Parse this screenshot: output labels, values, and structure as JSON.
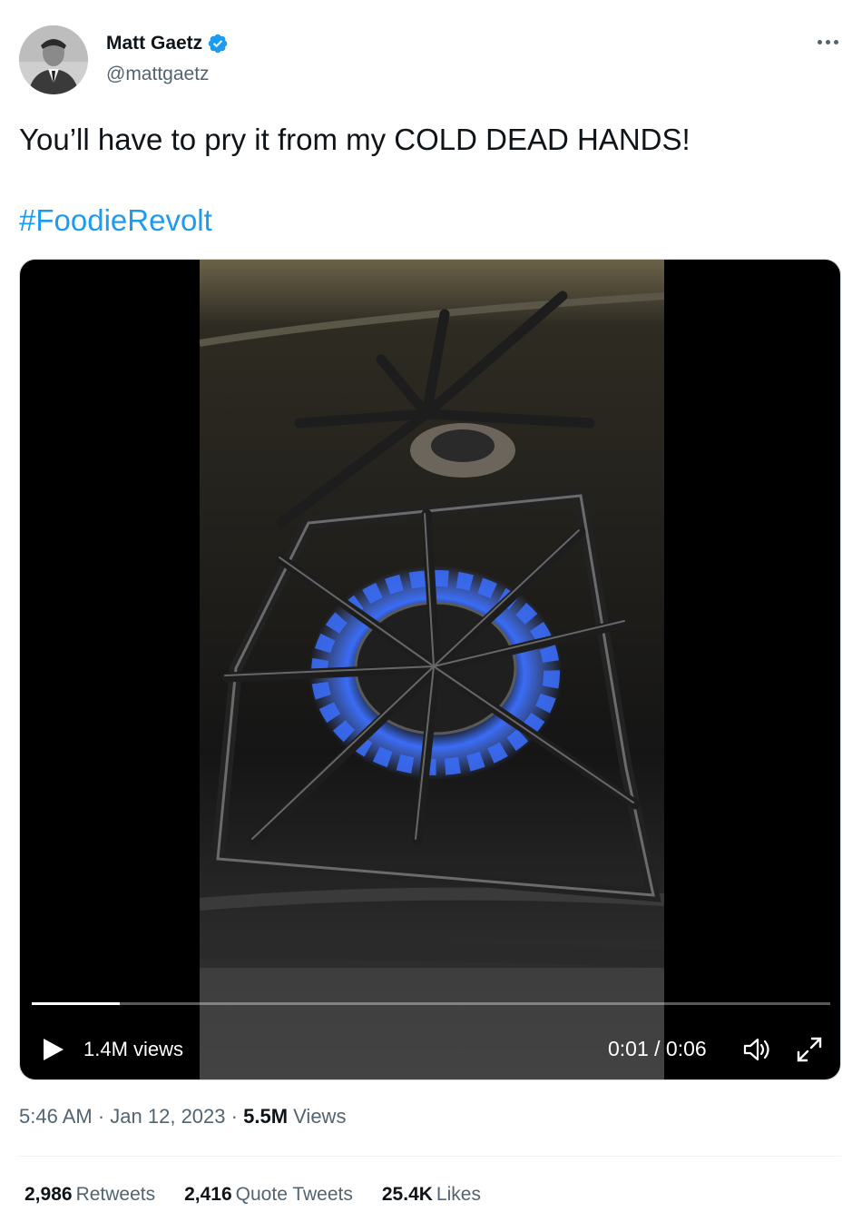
{
  "author": {
    "name": "Matt Gaetz",
    "handle": "@mattgaetz"
  },
  "tweet": {
    "text": "You’ll have to pry it from my COLD DEAD HANDS!",
    "hashtag": "#FoodieRevolt"
  },
  "video": {
    "views": "1.4M views",
    "time": "0:01 / 0:06",
    "progress": 0.11
  },
  "meta": {
    "time": "5:46 AM",
    "date": "Jan 12, 2023",
    "views_count": "5.5M",
    "views_label": "Views"
  },
  "stats": {
    "retweets_count": "2,986",
    "retweets_label": "Retweets",
    "quotes_count": "2,416",
    "quotes_label": "Quote Tweets",
    "likes_count": "25.4K",
    "likes_label": "Likes"
  },
  "colors": {
    "link": "#1d9bf0",
    "secondary_text": "#536471",
    "flame": "#3a6cf5"
  },
  "icons": [
    "verified-badge-icon",
    "more-options-icon",
    "play-icon",
    "volume-icon",
    "fullscreen-icon"
  ]
}
